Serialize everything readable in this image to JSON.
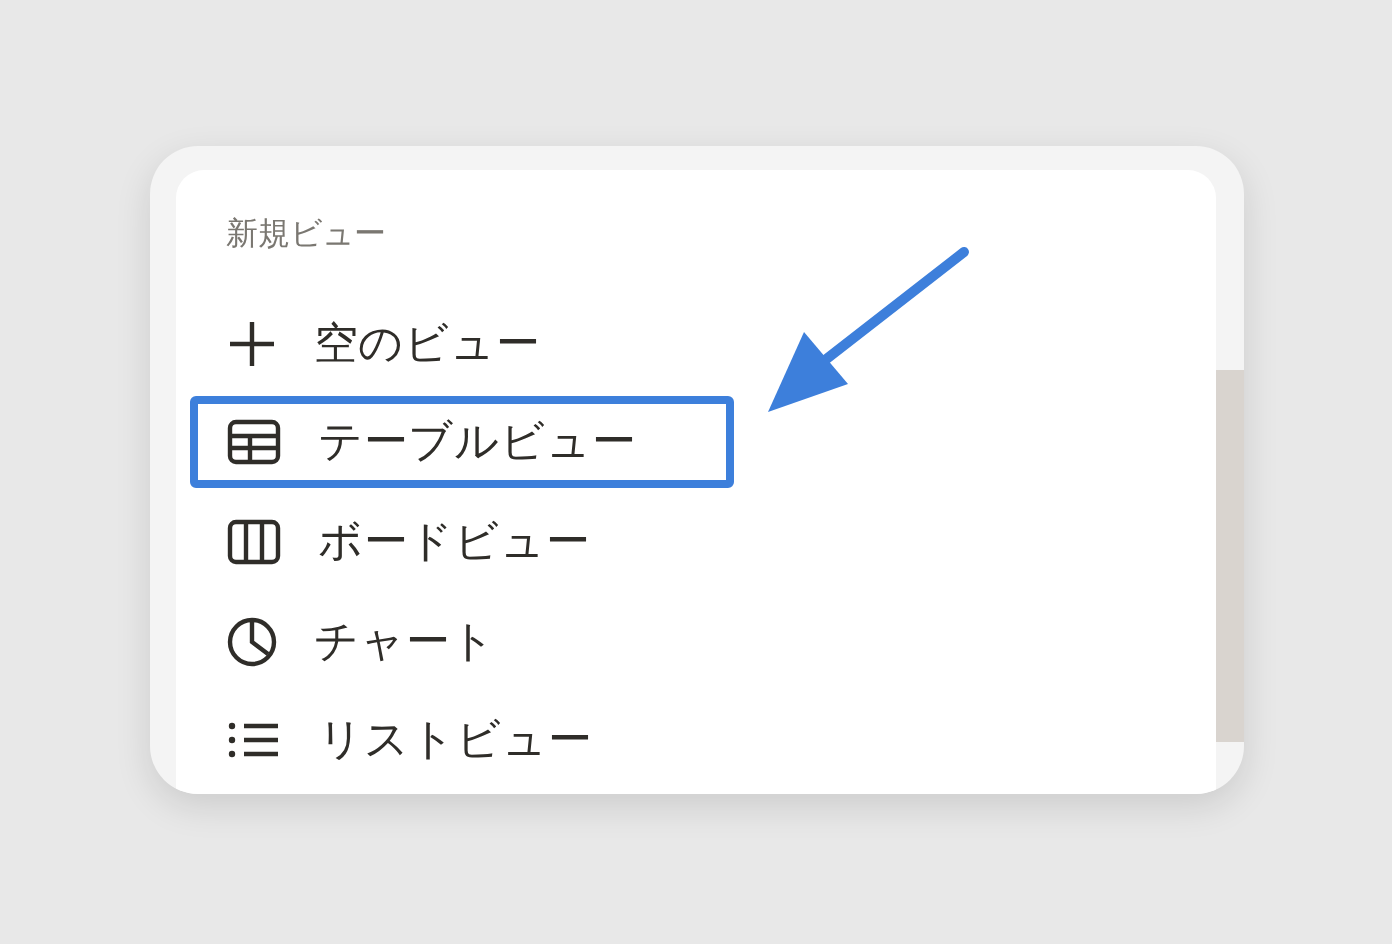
{
  "menu": {
    "heading": "新規ビュー",
    "items": [
      {
        "kind": "plus",
        "label": "空のビュー",
        "highlighted": false
      },
      {
        "kind": "table",
        "label": "テーブルビュー",
        "highlighted": true
      },
      {
        "kind": "board",
        "label": "ボードビュー",
        "highlighted": false
      },
      {
        "kind": "chart",
        "label": "チャート",
        "highlighted": false
      },
      {
        "kind": "list",
        "label": "リストビュー",
        "highlighted": false
      }
    ]
  }
}
